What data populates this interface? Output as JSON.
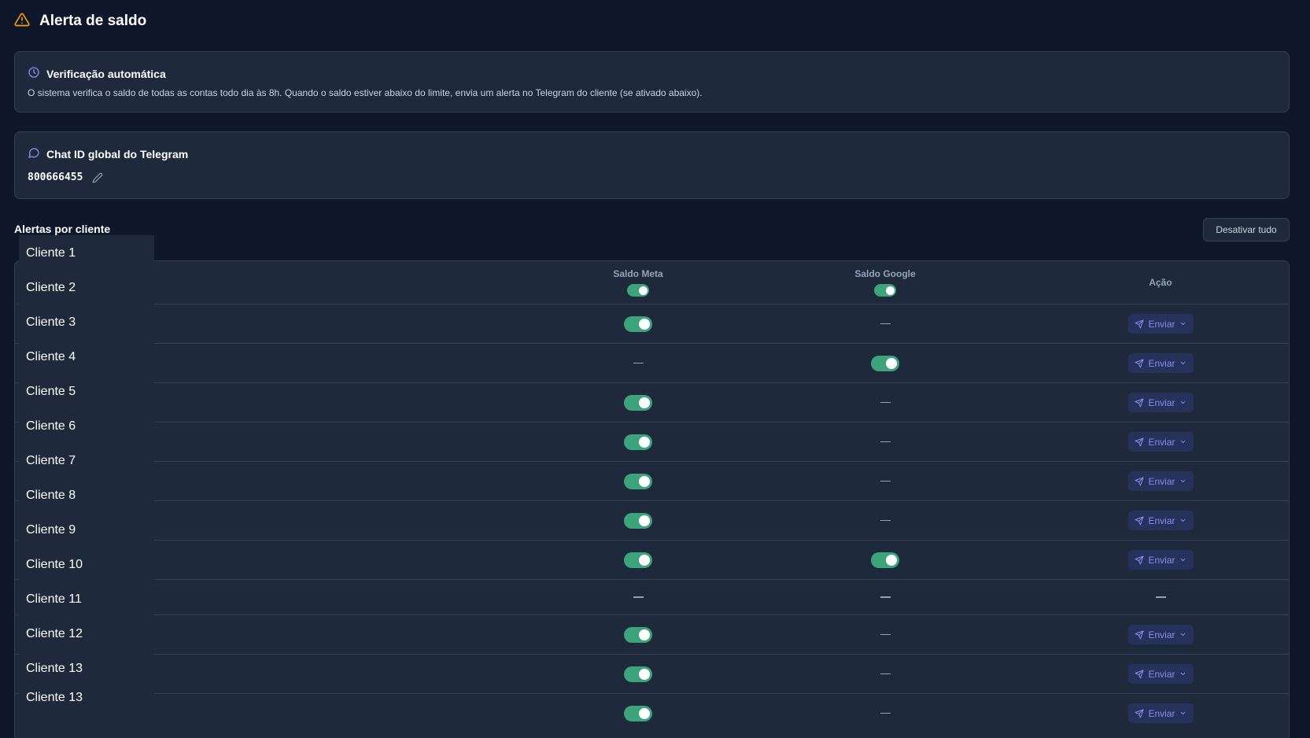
{
  "header": {
    "title": "Alerta de saldo",
    "icon": "warning-triangle-icon"
  },
  "info_card": {
    "title": "Verificação automática",
    "icon": "clock-icon",
    "description": "O sistema verifica o saldo de todas as contas todo dia às 8h. Quando o saldo estiver abaixo do limite, envia um alerta no Telegram do cliente (se ativado abaixo)."
  },
  "chat_card": {
    "title": "Chat ID global do Telegram",
    "icon": "chat-bubble-icon",
    "chat_id": "800666455",
    "edit_icon": "pencil-icon"
  },
  "alerts": {
    "title": "Alertas por cliente",
    "deactivate_all_label": "Desativar tudo",
    "columns": {
      "meta": "Saldo Meta",
      "google": "Saldo Google",
      "action": "Ação"
    },
    "header_toggles": {
      "meta": true,
      "google": true
    },
    "send_label": "Enviar",
    "rows": [
      {
        "meta": "on",
        "google": "none",
        "action": "send"
      },
      {
        "meta": "none",
        "google": "on",
        "action": "send"
      },
      {
        "meta": "on",
        "google": "none",
        "action": "send"
      },
      {
        "meta": "on",
        "google": "none",
        "action": "send"
      },
      {
        "meta": "on",
        "google": "none",
        "action": "send"
      },
      {
        "meta": "on",
        "google": "none",
        "action": "send"
      },
      {
        "meta": "on",
        "google": "on",
        "action": "send"
      },
      {
        "meta": "none",
        "google": "none",
        "action": "none"
      },
      {
        "meta": "on",
        "google": "none",
        "action": "send"
      },
      {
        "meta": "on",
        "google": "none",
        "action": "send"
      },
      {
        "meta": "on",
        "google": "none",
        "action": "send"
      }
    ]
  },
  "client_list": [
    "Cliente 1",
    "Cliente 2",
    "Cliente 3",
    "Cliente 4",
    "Cliente 5",
    "Cliente 6",
    "Cliente 7",
    "Cliente 8",
    "Cliente 9",
    "Cliente 10",
    "Cliente 11",
    "Cliente 12",
    "Cliente 13",
    "Cliente 13"
  ],
  "colors": {
    "accent_toggle": "#3ca37a",
    "accent_send": "#8b8cf0",
    "warning": "#f59e0b",
    "background": "#0f172a"
  }
}
